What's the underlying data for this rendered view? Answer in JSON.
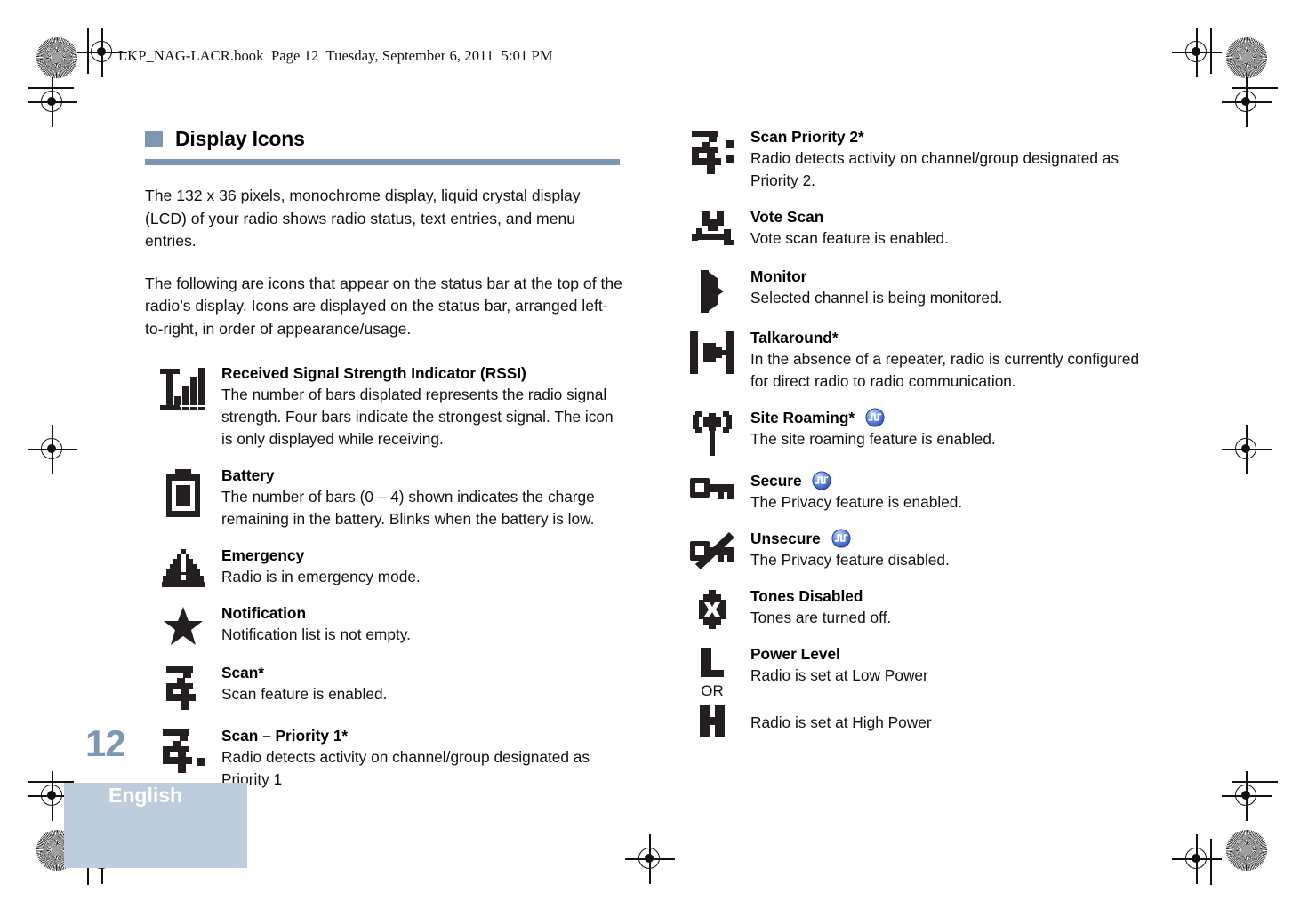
{
  "file_header": "LKP_NAG-LACR.book  Page 12  Tuesday, September 6, 2011  5:01 PM",
  "section": {
    "title": "Display Icons",
    "paragraphs": [
      "The 132 x 36 pixels, monochrome display, liquid crystal display (LCD) of your radio shows radio status, text entries, and menu entries.",
      "The following are icons that appear on the status bar at the top of the radio’s display. Icons are displayed on the status bar, arranged left-to-right, in order of appearance/usage."
    ]
  },
  "colors": {
    "accent": "#7d97b3",
    "footer_box": "#bdcddb",
    "badge_blue": "#4a6fd4",
    "ink": "#231f20"
  },
  "left_column": [
    {
      "icon": "rssi-signal-bars-icon",
      "heading": "Received Signal Strength Indicator (RSSI)",
      "body": "The number of bars displated represents the radio signal strength. Four bars indicate the strongest signal. The icon is only displayed while receiving."
    },
    {
      "icon": "battery-icon",
      "heading": "Battery",
      "body": "The number of bars (0 – 4) shown indicates the charge remaining in the battery. Blinks when the battery is low."
    },
    {
      "icon": "emergency-warning-triangle-icon",
      "heading": "Emergency",
      "body": "Radio is in emergency mode."
    },
    {
      "icon": "notification-star-icon",
      "heading": "Notification",
      "body": "Notification list is not empty."
    },
    {
      "icon": "scan-icon",
      "heading": "Scan*",
      "body": "Scan feature is enabled."
    },
    {
      "icon": "scan-priority-1-icon",
      "heading": "Scan – Priority 1*",
      "body": "Radio detects activity on channel/group designated as Priority 1"
    }
  ],
  "right_column": [
    {
      "icon": "scan-priority-2-icon",
      "heading": "Scan Priority 2*",
      "body": "Radio detects activity on channel/group designated as Priority 2.",
      "badge": false
    },
    {
      "icon": "vote-scan-icon",
      "heading": "Vote Scan",
      "body": "Vote scan feature is enabled.",
      "badge": false
    },
    {
      "icon": "monitor-icon",
      "heading": "Monitor",
      "body": "Selected channel is being monitored.",
      "badge": false
    },
    {
      "icon": "talkaround-icon",
      "heading": "Talkaround*",
      "body": "In the absence of a repeater, radio is currently configured for direct radio to radio communication.",
      "badge": false
    },
    {
      "icon": "site-roaming-antenna-icon",
      "heading": "Site Roaming*",
      "body": "The site roaming feature is enabled.",
      "badge": true
    },
    {
      "icon": "secure-key-icon",
      "heading": "Secure",
      "body": "The Privacy feature is enabled.",
      "badge": true
    },
    {
      "icon": "unsecure-key-slash-icon",
      "heading": "Unsecure",
      "body": "The Privacy feature disabled.",
      "badge": true
    },
    {
      "icon": "tones-disabled-bell-icon",
      "heading": "Tones Disabled",
      "body": "Tones are turned off.",
      "badge": false
    }
  ],
  "power_level": {
    "icon_low": "power-low-l-icon",
    "or_label": "OR",
    "icon_high": "power-high-h-icon",
    "heading": "Power Level",
    "body_low": "Radio is set at Low Power",
    "body_high": "Radio is set at High Power"
  },
  "footer": {
    "page_number": "12",
    "language": "English"
  }
}
